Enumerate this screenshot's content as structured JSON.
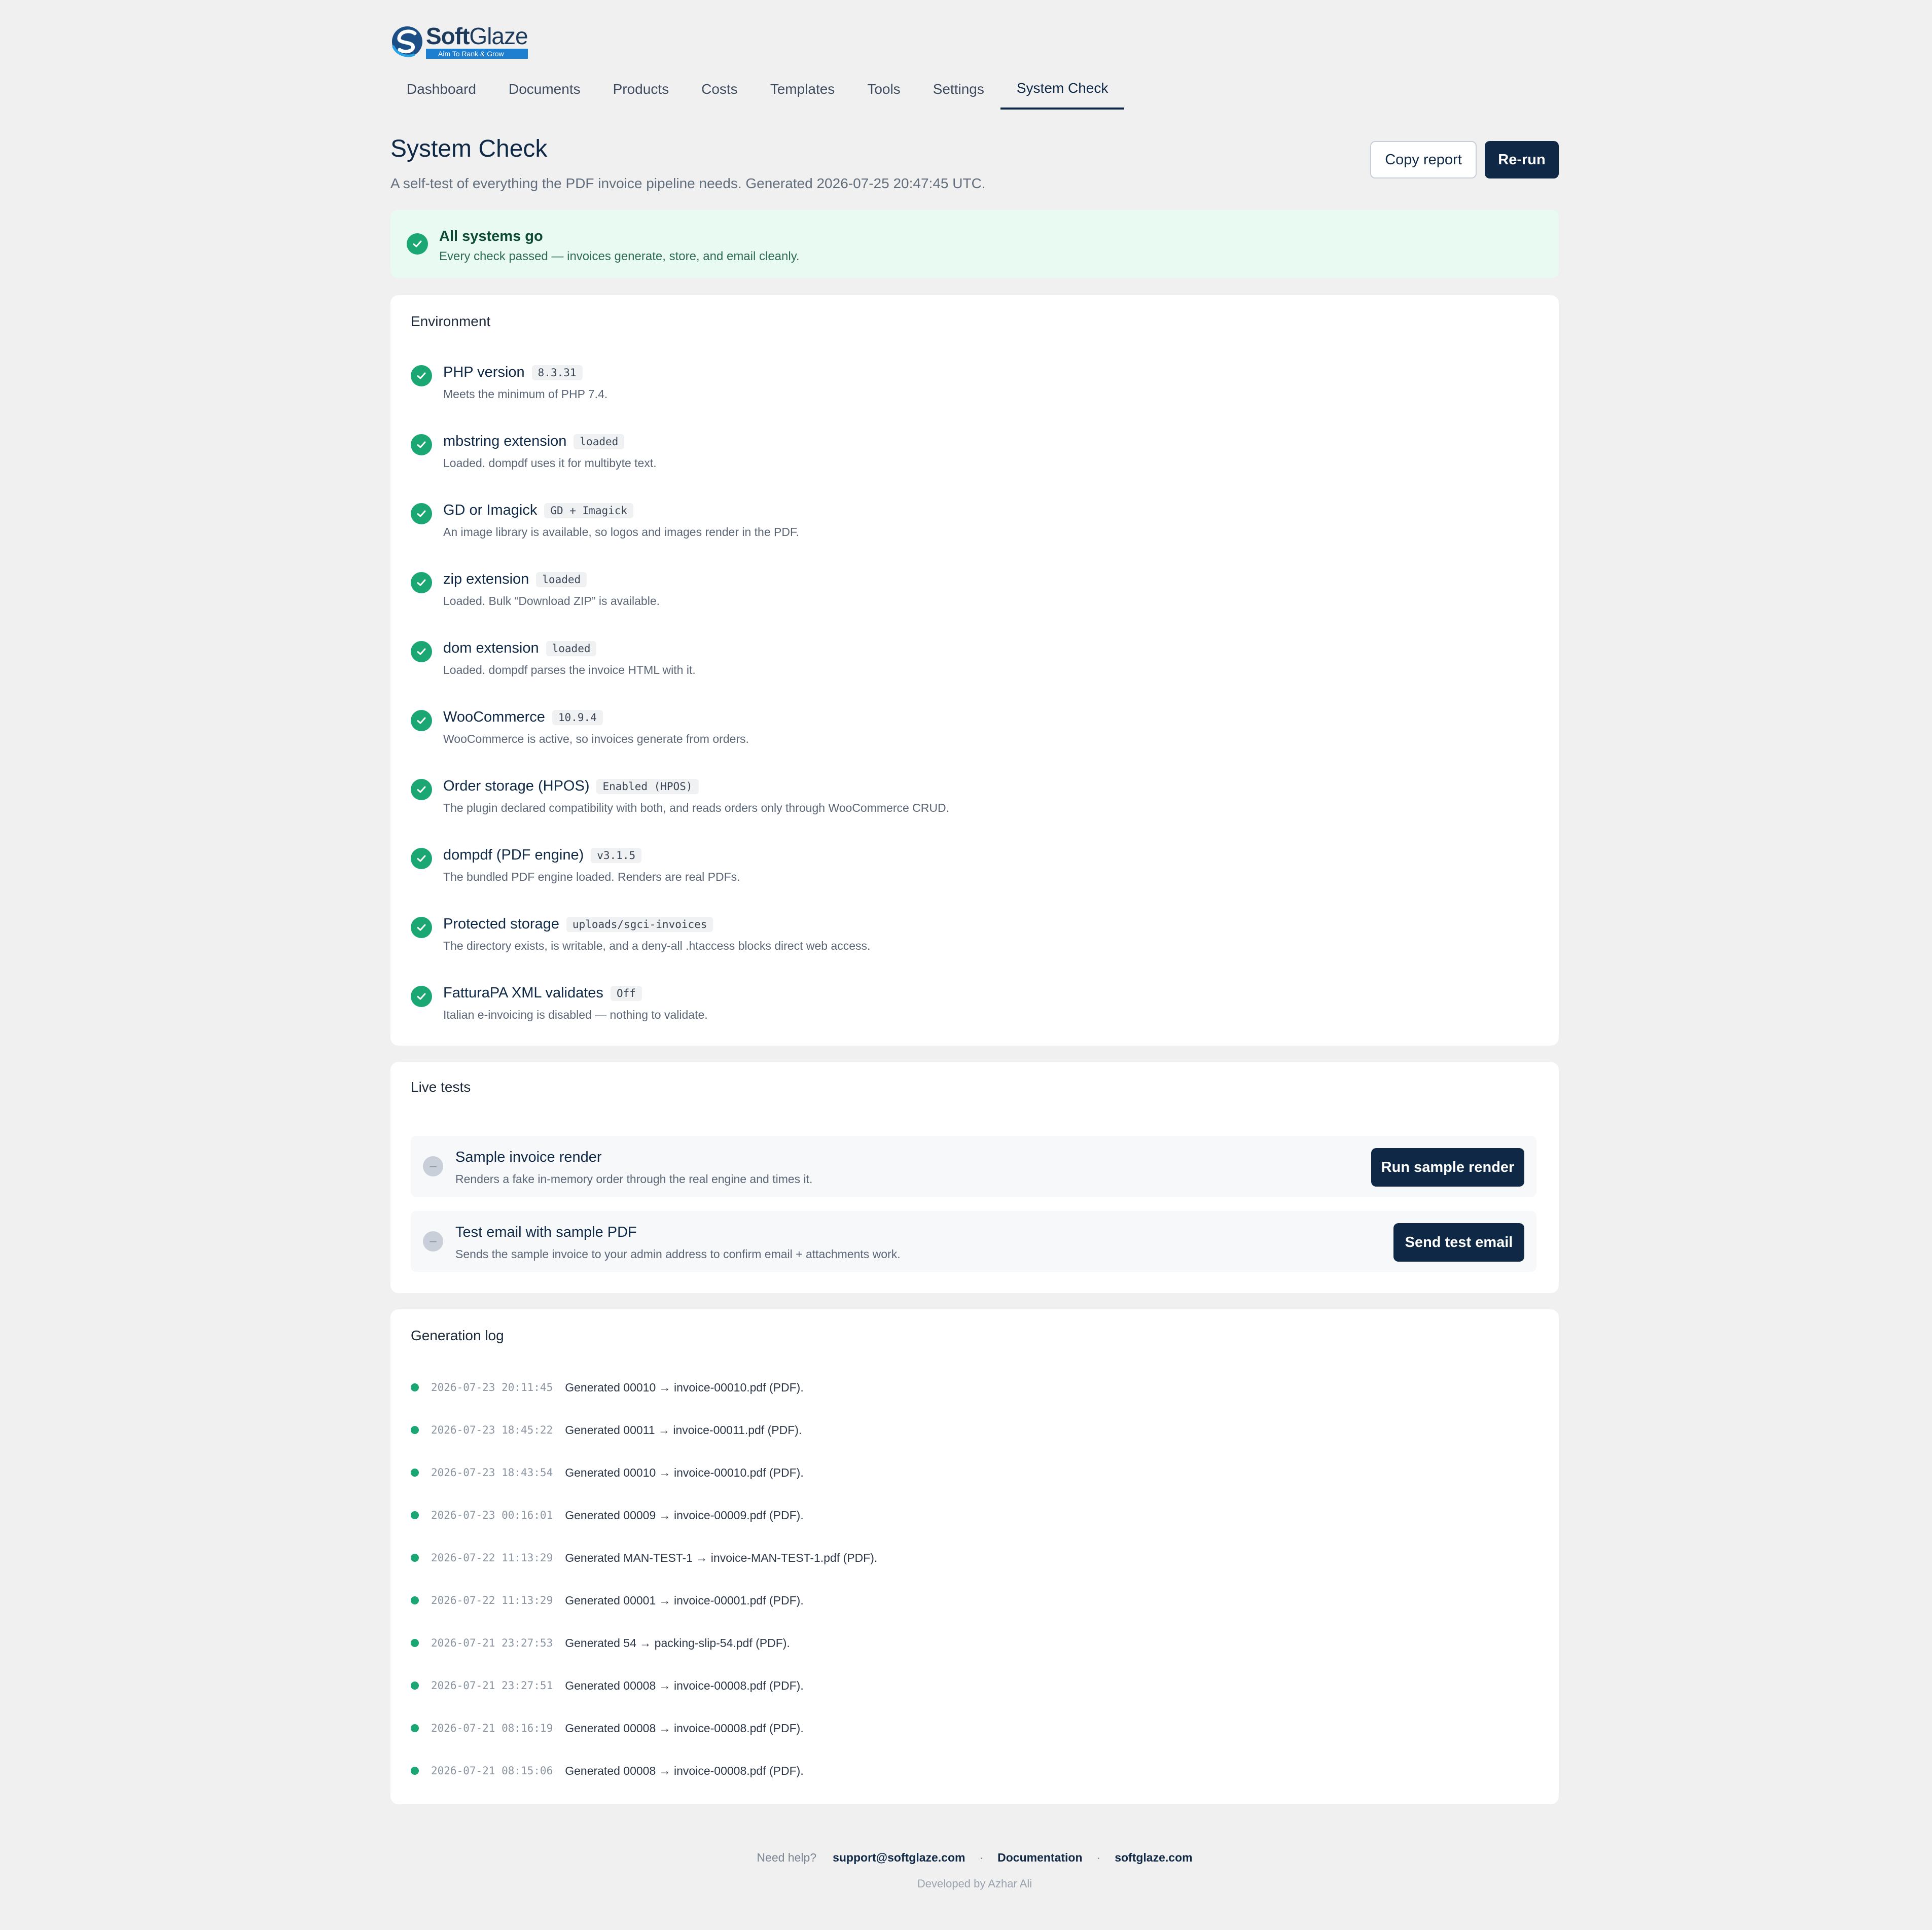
{
  "brand": {
    "name_a": "Soft",
    "name_b": "Glaze",
    "tagline": "Aim To Rank & Grow"
  },
  "nav": {
    "tabs": [
      {
        "label": "Dashboard"
      },
      {
        "label": "Documents"
      },
      {
        "label": "Products"
      },
      {
        "label": "Costs"
      },
      {
        "label": "Templates"
      },
      {
        "label": "Tools"
      },
      {
        "label": "Settings"
      },
      {
        "label": "System Check",
        "active": true
      }
    ]
  },
  "header": {
    "title": "System Check",
    "subtitle": "A self-test of everything the PDF invoice pipeline needs. Generated 2026-07-25 20:47:45 UTC.",
    "copy_label": "Copy report",
    "rerun_label": "Re-run"
  },
  "banner": {
    "title": "All systems go",
    "text": "Every check passed — invoices generate, store, and email cleanly."
  },
  "environment": {
    "title": "Environment",
    "items": [
      {
        "name": "PHP version",
        "badge": "8.3.31",
        "desc": "Meets the minimum of PHP 7.4."
      },
      {
        "name": "mbstring extension",
        "badge": "loaded",
        "desc": "Loaded. dompdf uses it for multibyte text."
      },
      {
        "name": "GD or Imagick",
        "badge": "GD + Imagick",
        "desc": "An image library is available, so logos and images render in the PDF."
      },
      {
        "name": "zip extension",
        "badge": "loaded",
        "desc": "Loaded. Bulk “Download ZIP” is available."
      },
      {
        "name": "dom extension",
        "badge": "loaded",
        "desc": "Loaded. dompdf parses the invoice HTML with it."
      },
      {
        "name": "WooCommerce",
        "badge": "10.9.4",
        "desc": "WooCommerce is active, so invoices generate from orders."
      },
      {
        "name": "Order storage (HPOS)",
        "badge": "Enabled (HPOS)",
        "desc": "The plugin declared compatibility with both, and reads orders only through WooCommerce CRUD."
      },
      {
        "name": "dompdf (PDF engine)",
        "badge": "v3.1.5",
        "desc": "The bundled PDF engine loaded. Renders are real PDFs."
      },
      {
        "name": "Protected storage",
        "badge": "uploads/sgci-invoices",
        "desc": "The directory exists, is writable, and a deny-all .htaccess blocks direct web access."
      },
      {
        "name": "FatturaPA XML validates",
        "badge": "Off",
        "desc": "Italian e-invoicing is disabled — nothing to validate."
      }
    ]
  },
  "live_tests": {
    "title": "Live tests",
    "items": [
      {
        "name": "Sample invoice render",
        "desc": "Renders a fake in-memory order through the real engine and times it.",
        "button": "Run sample render",
        "status": "–"
      },
      {
        "name": "Test email with sample PDF",
        "desc": "Sends the sample invoice to your admin address to confirm email + attachments work.",
        "button": "Send test email",
        "status": "–"
      }
    ]
  },
  "log": {
    "title": "Generation log",
    "entries": [
      {
        "time": "2026-07-23 20:11:45",
        "msg": "Generated 00010 → invoice-00010.pdf (PDF)."
      },
      {
        "time": "2026-07-23 18:45:22",
        "msg": "Generated 00011 → invoice-00011.pdf (PDF)."
      },
      {
        "time": "2026-07-23 18:43:54",
        "msg": "Generated 00010 → invoice-00010.pdf (PDF)."
      },
      {
        "time": "2026-07-23 00:16:01",
        "msg": "Generated 00009 → invoice-00009.pdf (PDF)."
      },
      {
        "time": "2026-07-22 11:13:29",
        "msg": "Generated MAN-TEST-1 → invoice-MAN-TEST-1.pdf (PDF)."
      },
      {
        "time": "2026-07-22 11:13:29",
        "msg": "Generated 00001 → invoice-00001.pdf (PDF)."
      },
      {
        "time": "2026-07-21 23:27:53",
        "msg": "Generated 54 → packing-slip-54.pdf (PDF)."
      },
      {
        "time": "2026-07-21 23:27:51",
        "msg": "Generated 00008 → invoice-00008.pdf (PDF)."
      },
      {
        "time": "2026-07-21 08:16:19",
        "msg": "Generated 00008 → invoice-00008.pdf (PDF)."
      },
      {
        "time": "2026-07-21 08:15:06",
        "msg": "Generated 00008 → invoice-00008.pdf (PDF)."
      }
    ]
  },
  "footer": {
    "help": "Need help?",
    "email": "support@softglaze.com",
    "docs": "Documentation",
    "site": "softglaze.com",
    "sep": "·",
    "developer": "Developed by Azhar Ali"
  },
  "colors": {
    "primary": "#0e2845",
    "success": "#1aa774",
    "banner_bg": "#e8faf2",
    "page_bg": "#f0f0f1"
  },
  "icons": {
    "check": "check-icon",
    "pending": "pending-icon",
    "logo": "softglaze-logo-icon"
  }
}
